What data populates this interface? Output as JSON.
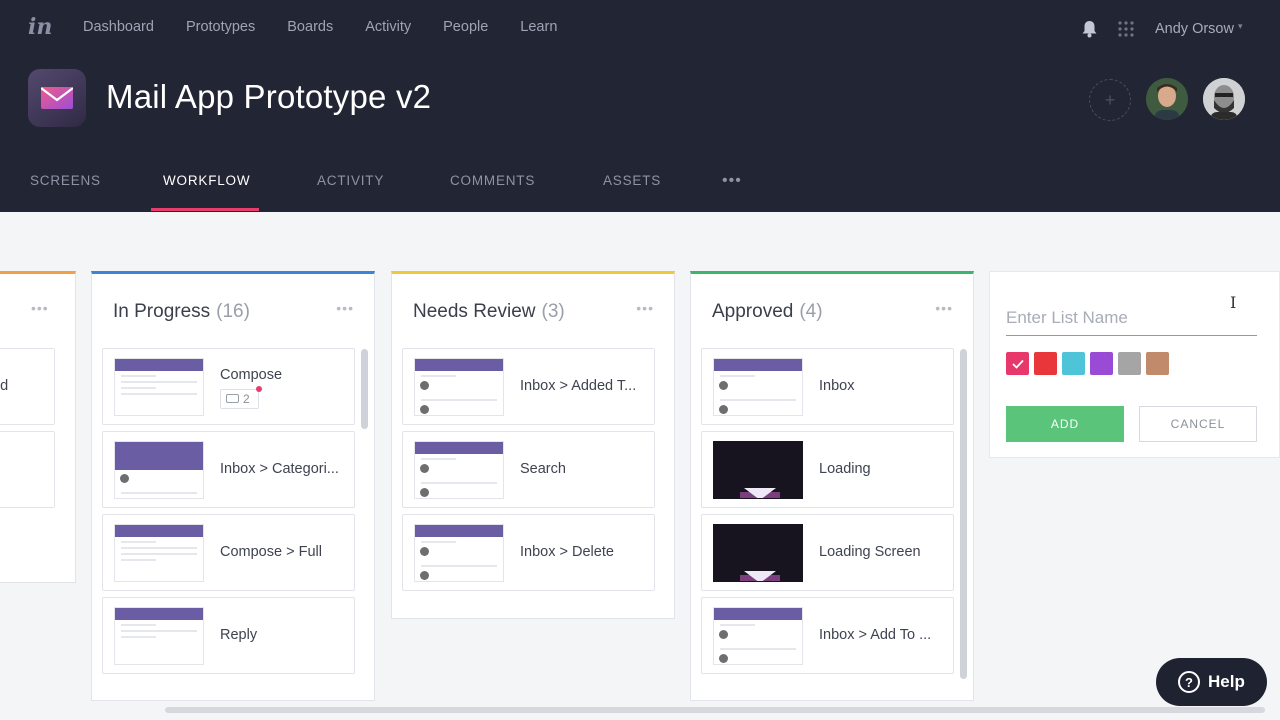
{
  "topnav": {
    "logo": "in",
    "items": [
      "Dashboard",
      "Prototypes",
      "Boards",
      "Activity",
      "People",
      "Learn"
    ],
    "user_name": "Andy Orsow"
  },
  "project": {
    "title": "Mail App Prototype v2",
    "add_collaborator": "+"
  },
  "tabs": [
    "SCREENS",
    "WORKFLOW",
    "ACTIVITY",
    "COMMENTS",
    "ASSETS"
  ],
  "active_tab": "WORKFLOW",
  "tab_more": "•••",
  "columns": {
    "partial": {
      "cards": [
        "ted",
        ""
      ]
    },
    "in_progress": {
      "title": "In Progress",
      "count": "(16)",
      "cards": [
        {
          "label": "Compose",
          "comments": "2"
        },
        {
          "label": "Inbox > Categori..."
        },
        {
          "label": "Compose > Full"
        },
        {
          "label": "Reply"
        }
      ]
    },
    "needs_review": {
      "title": "Needs Review",
      "count": "(3)",
      "cards": [
        {
          "label": "Inbox > Added T..."
        },
        {
          "label": "Search"
        },
        {
          "label": "Inbox > Delete"
        }
      ]
    },
    "approved": {
      "title": "Approved",
      "count": "(4)",
      "cards": [
        {
          "label": "Inbox"
        },
        {
          "label": "Loading"
        },
        {
          "label": "Loading Screen"
        },
        {
          "label": "Inbox > Add To ..."
        }
      ]
    }
  },
  "column_more": "•••",
  "new_list": {
    "placeholder": "Enter List Name",
    "swatches": [
      "#e8386b",
      "#e8363a",
      "#4ec4d8",
      "#9a4bd6",
      "#a5a5a5",
      "#c08a6b"
    ],
    "add_label": "ADD",
    "cancel_label": "CANCEL"
  },
  "help_label": "Help",
  "colors": {
    "header_bg": "#222533",
    "accent": "#e53e6d",
    "add_green": "#59c47a"
  }
}
